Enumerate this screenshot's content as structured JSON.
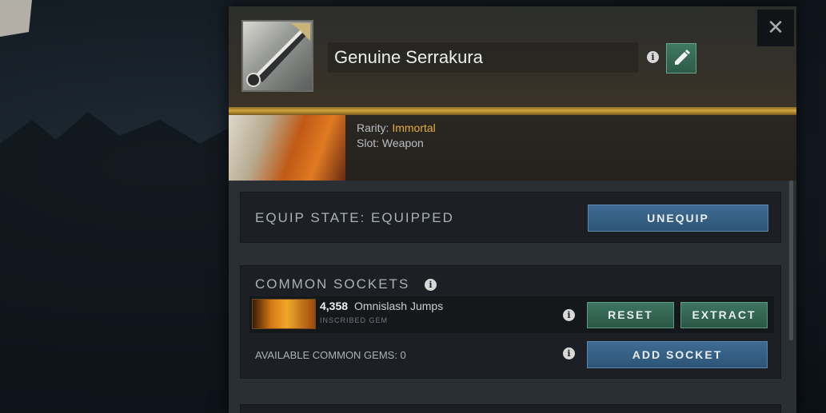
{
  "item": {
    "name": "Genuine Serrakura",
    "rarity_label": "Rarity:",
    "rarity_value": "Immortal",
    "slot_label": "Slot:",
    "slot_value": "Weapon",
    "close_glyph": "✕",
    "info_glyph": "i",
    "edit_icon": "pencil-icon"
  },
  "equip": {
    "state_text": "EQUIP STATE: EQUIPPED",
    "button_label": "UNEQUIP"
  },
  "sockets": {
    "title": "COMMON SOCKETS",
    "gem": {
      "count": "4,358",
      "name": "Omnislash Jumps",
      "type": "INSCRIBED GEM"
    },
    "reset_label": "RESET",
    "extract_label": "EXTRACT",
    "available_text": "AVAILABLE COMMON GEMS: 0",
    "add_socket_label": "ADD SOCKET"
  },
  "colors": {
    "rarity_immortal": "#e4ae39",
    "button_blue": "#2e5577",
    "button_green": "#2b5746"
  }
}
